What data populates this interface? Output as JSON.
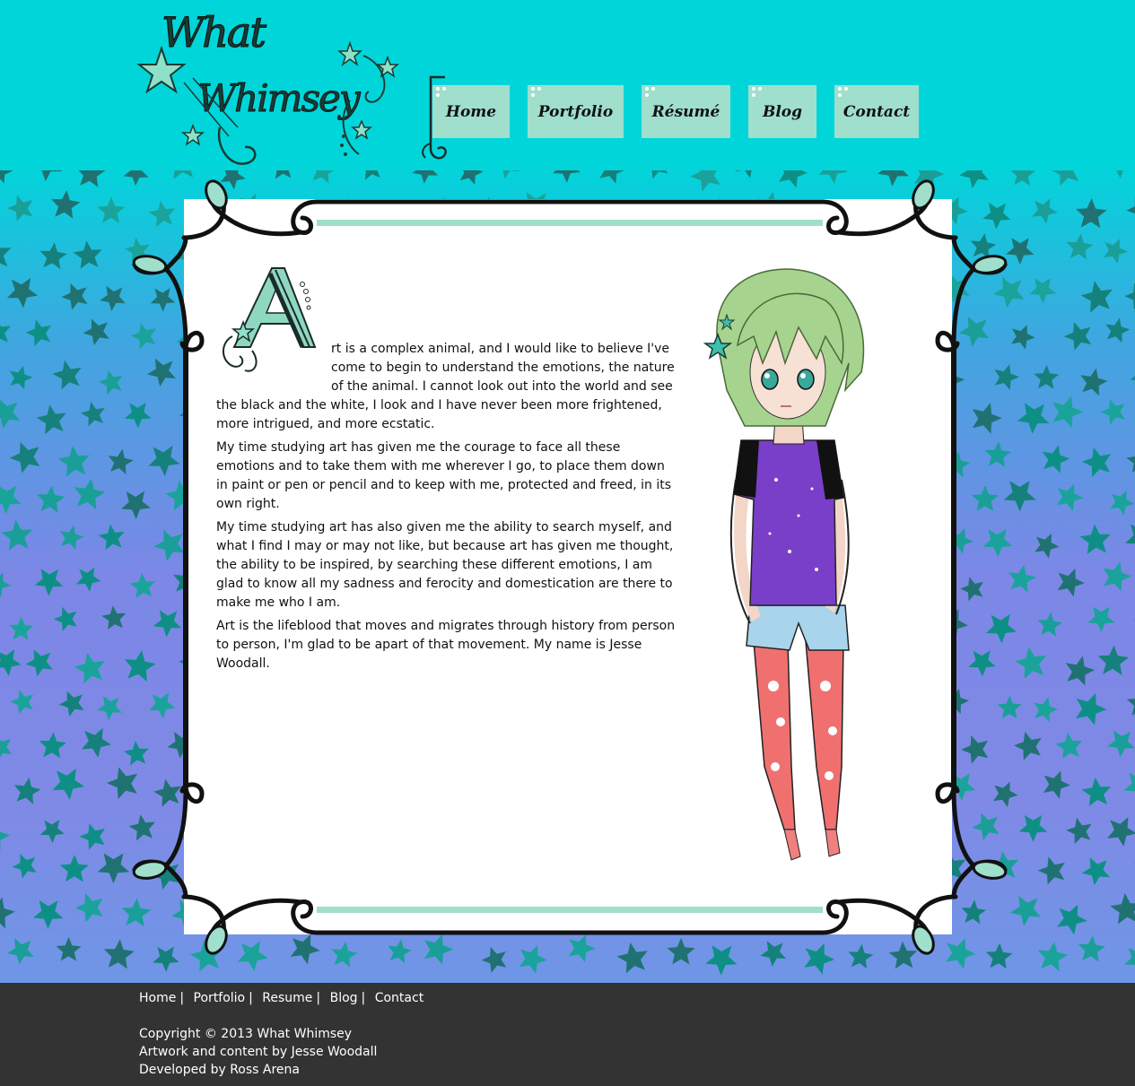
{
  "site": {
    "logo_text": "What Whimsey",
    "colors": {
      "cyan": "#00d6da",
      "mint": "#9fdfcc",
      "teal_star": "#1aa39a",
      "footer": "#333333"
    }
  },
  "nav": {
    "items": [
      {
        "label": "Home"
      },
      {
        "label": "Portfolio"
      },
      {
        "label": "Résumé"
      },
      {
        "label": "Blog"
      },
      {
        "label": "Contact"
      }
    ]
  },
  "article": {
    "dropcap": "A",
    "paragraphs": [
      "rt is a complex animal, and I would like to believe I've come to begin to understand the emotions, the nature of the animal. I cannot look out into the world and see the black and the white, I look and I have never been more frightened, more intrigued, and more ecstatic.",
      "My time studying art has given me the courage to face all these emotions and to take them with me wherever I go, to place them down in paint or pen or pencil and to keep with me, protected and freed, in its own right.",
      "My time studying art has also given me the ability to search myself, and what I find I may or may not like, but because art has given me thought, the ability to be inspired, by searching these different emotions, I am glad to know all my sadness and ferocity and domestication are there to make me who I am.",
      "Art is the lifeblood that moves and migrates through history from person to person, I'm glad to be apart of that movement. My name is Jesse Woodall."
    ]
  },
  "footer": {
    "links": [
      {
        "label": "Home"
      },
      {
        "label": "Portfolio"
      },
      {
        "label": "Resume"
      },
      {
        "label": "Blog"
      },
      {
        "label": "Contact"
      }
    ],
    "separator": "|",
    "copyright": "Copyright © 2013 What Whimsey",
    "artwork": "Artwork and content by Jesse Woodall",
    "developer": "Developed by Ross Arena"
  }
}
